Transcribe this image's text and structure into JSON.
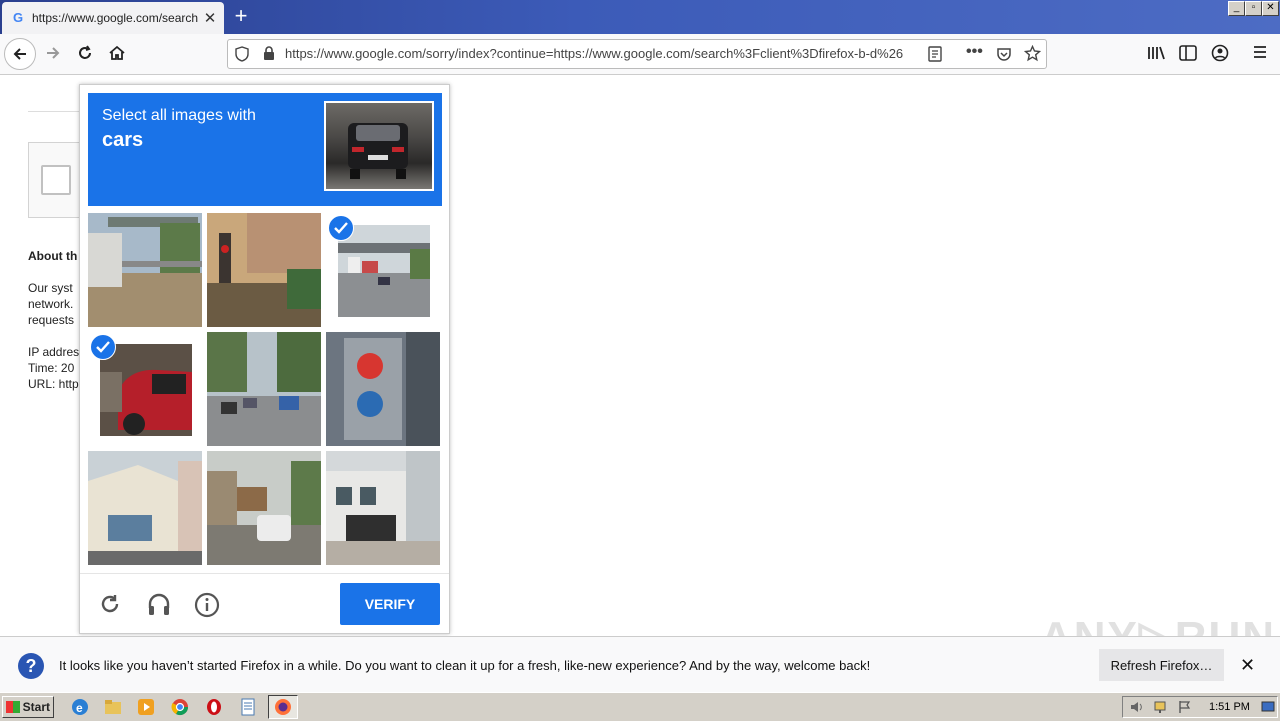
{
  "browser": {
    "tab_title": "https://www.google.com/search?c",
    "tab_favicon": "G",
    "url": "https://www.google.com/sorry/index?continue=https://www.google.com/search%3Fclient%3Dfirefox-b-d%26"
  },
  "background_page": {
    "heading": "About th",
    "line1": "Our syst",
    "line2": "network.",
    "line3": "requests",
    "line4": "IP addres",
    "line5": "Time: 20",
    "line6": "URL: http"
  },
  "captcha": {
    "instruction": "Select all images with",
    "target": "cars",
    "verify_label": "VERIFY",
    "tiles": [
      {
        "name": "tile-1",
        "selected": false
      },
      {
        "name": "tile-2",
        "selected": false
      },
      {
        "name": "tile-3",
        "selected": true
      },
      {
        "name": "tile-4",
        "selected": true
      },
      {
        "name": "tile-5",
        "selected": false
      },
      {
        "name": "tile-6",
        "selected": false
      },
      {
        "name": "tile-7",
        "selected": false
      },
      {
        "name": "tile-8",
        "selected": false
      },
      {
        "name": "tile-9",
        "selected": false
      }
    ],
    "footer_icons": [
      "reload-icon",
      "headphones-icon",
      "info-icon"
    ]
  },
  "notification": {
    "text": "It looks like you haven’t started Firefox in a while. Do you want to clean it up for a fresh, like-new experience? And by the way, welcome back!",
    "button_label": "Refresh Firefox…"
  },
  "taskbar": {
    "start_label": "Start",
    "clock": "1:51 PM"
  },
  "colors": {
    "accent": "#1a73e8",
    "notification_icon": "#2a56b3"
  }
}
